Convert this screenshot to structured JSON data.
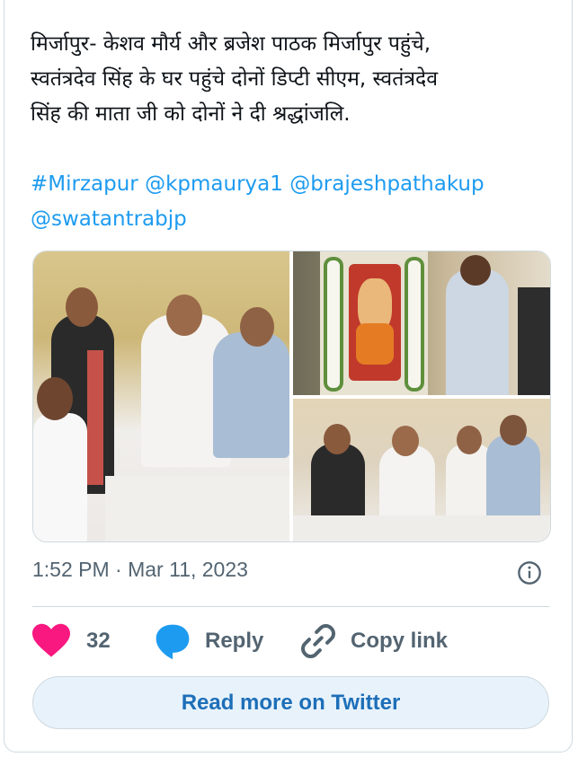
{
  "tweet": {
    "text_lines": [
      "मिर्जापुर- केशव मौर्य और ब्रजेश पाठक मिर्जापुर पहुंचे,",
      "स्वतंत्रदेव सिंह के घर पहुंचे दोनों डिप्टी सीएम, स्वतंत्रदेव",
      "सिंह की माता जी को दोनों ने दी श्रद्धांजलि."
    ],
    "hashtag": "#Mirzapur",
    "mentions": [
      "@kpmaurya1",
      "@brajeshpathakup",
      "@swatantrabjp"
    ],
    "time": "1:52 PM",
    "separator": "·",
    "date": "Mar 11, 2023"
  },
  "actions": {
    "like_count": "32",
    "reply_label": "Reply",
    "copy_label": "Copy link"
  },
  "read_more_label": "Read more on Twitter",
  "colors": {
    "accent": "#1d9bf0",
    "like": "#f91880",
    "muted": "#536471",
    "border": "#cfd9de"
  },
  "icons": {
    "like": "heart-icon",
    "reply": "reply-bubble-icon",
    "copy": "link-icon",
    "info": "info-icon"
  }
}
